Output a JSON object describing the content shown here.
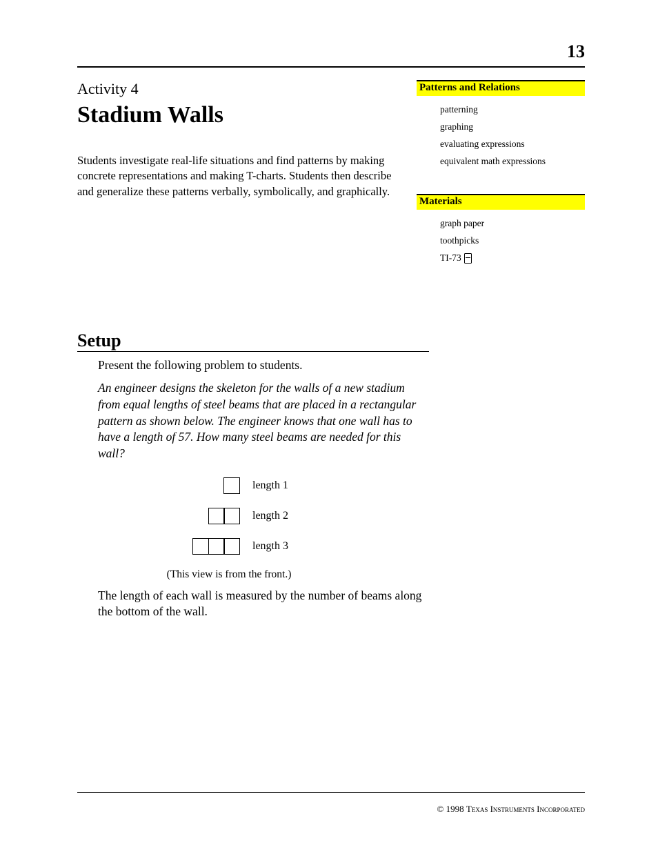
{
  "page_number": "13",
  "header": {
    "activity_label": "Activity 4",
    "title": "Stadium Walls",
    "intro": "Students investigate real-life situations and find patterns by making concrete representations and making T-charts. Students then describe and generalize these patterns verbally, symbolically, and graphically."
  },
  "sidebar": {
    "patterns_head": "Patterns and Relations",
    "patterns": [
      "patterning",
      "graphing",
      "evaluating expressions",
      "equivalent math expressions"
    ],
    "materials_head": "Materials",
    "materials": [
      "graph paper",
      "toothpicks",
      "TI-73"
    ]
  },
  "setup": {
    "heading": "Setup",
    "p1": "Present the following problem to students.",
    "p2": "An engineer designs the skeleton for the walls of a new stadium from equal lengths of steel beams that are placed in a rectangular pattern as shown below. The engineer knows that one wall has to have a length of 57. How many steel beams are needed for this wall?",
    "fig_labels": [
      "length 1",
      "length 2",
      "length 3"
    ],
    "caption": "(This view is from the front.)",
    "p3": "The length of each wall is measured by the number of beams along the bottom of the wall."
  },
  "footer": {
    "copyright_prefix": "© 1998 ",
    "copyright_name": "Texas Instruments Incorporated"
  }
}
